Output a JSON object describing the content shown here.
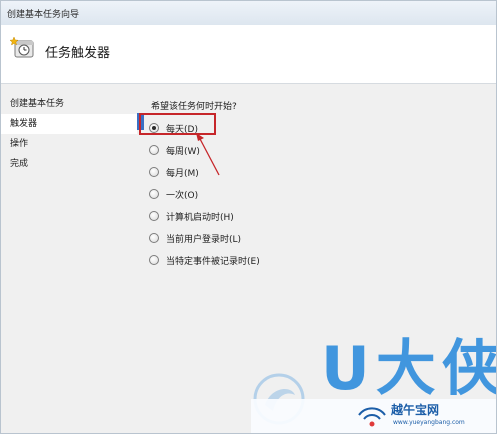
{
  "window": {
    "title": "创建基本任务向导"
  },
  "header": {
    "icon": "task-clock-icon",
    "title": "任务触发器"
  },
  "sidebar": {
    "items": [
      {
        "label": "创建基本任务",
        "active": false
      },
      {
        "label": "触发器",
        "active": true
      },
      {
        "label": "操作",
        "active": false
      },
      {
        "label": "完成",
        "active": false
      }
    ]
  },
  "main": {
    "question": "希望该任务何时开始?",
    "options": [
      {
        "label": "每天(D)",
        "checked": true
      },
      {
        "label": "每周(W)",
        "checked": false
      },
      {
        "label": "每月(M)",
        "checked": false
      },
      {
        "label": "一次(O)",
        "checked": false
      },
      {
        "label": "计算机启动时(H)",
        "checked": false
      },
      {
        "label": "当前用户登录时(L)",
        "checked": false
      },
      {
        "label": "当特定事件被记录时(E)",
        "checked": false
      }
    ]
  },
  "annotation": {
    "box_color": "#c6262a",
    "arrow_color": "#c6262a"
  },
  "watermark": {
    "big_text": "U大侠",
    "brand": "越午宝网",
    "url": "www.yueyangbang.com",
    "color": "#2e8cdc"
  },
  "colors": {
    "accent": "#3a6fc4",
    "panel_bg": "#f0f0f0"
  }
}
